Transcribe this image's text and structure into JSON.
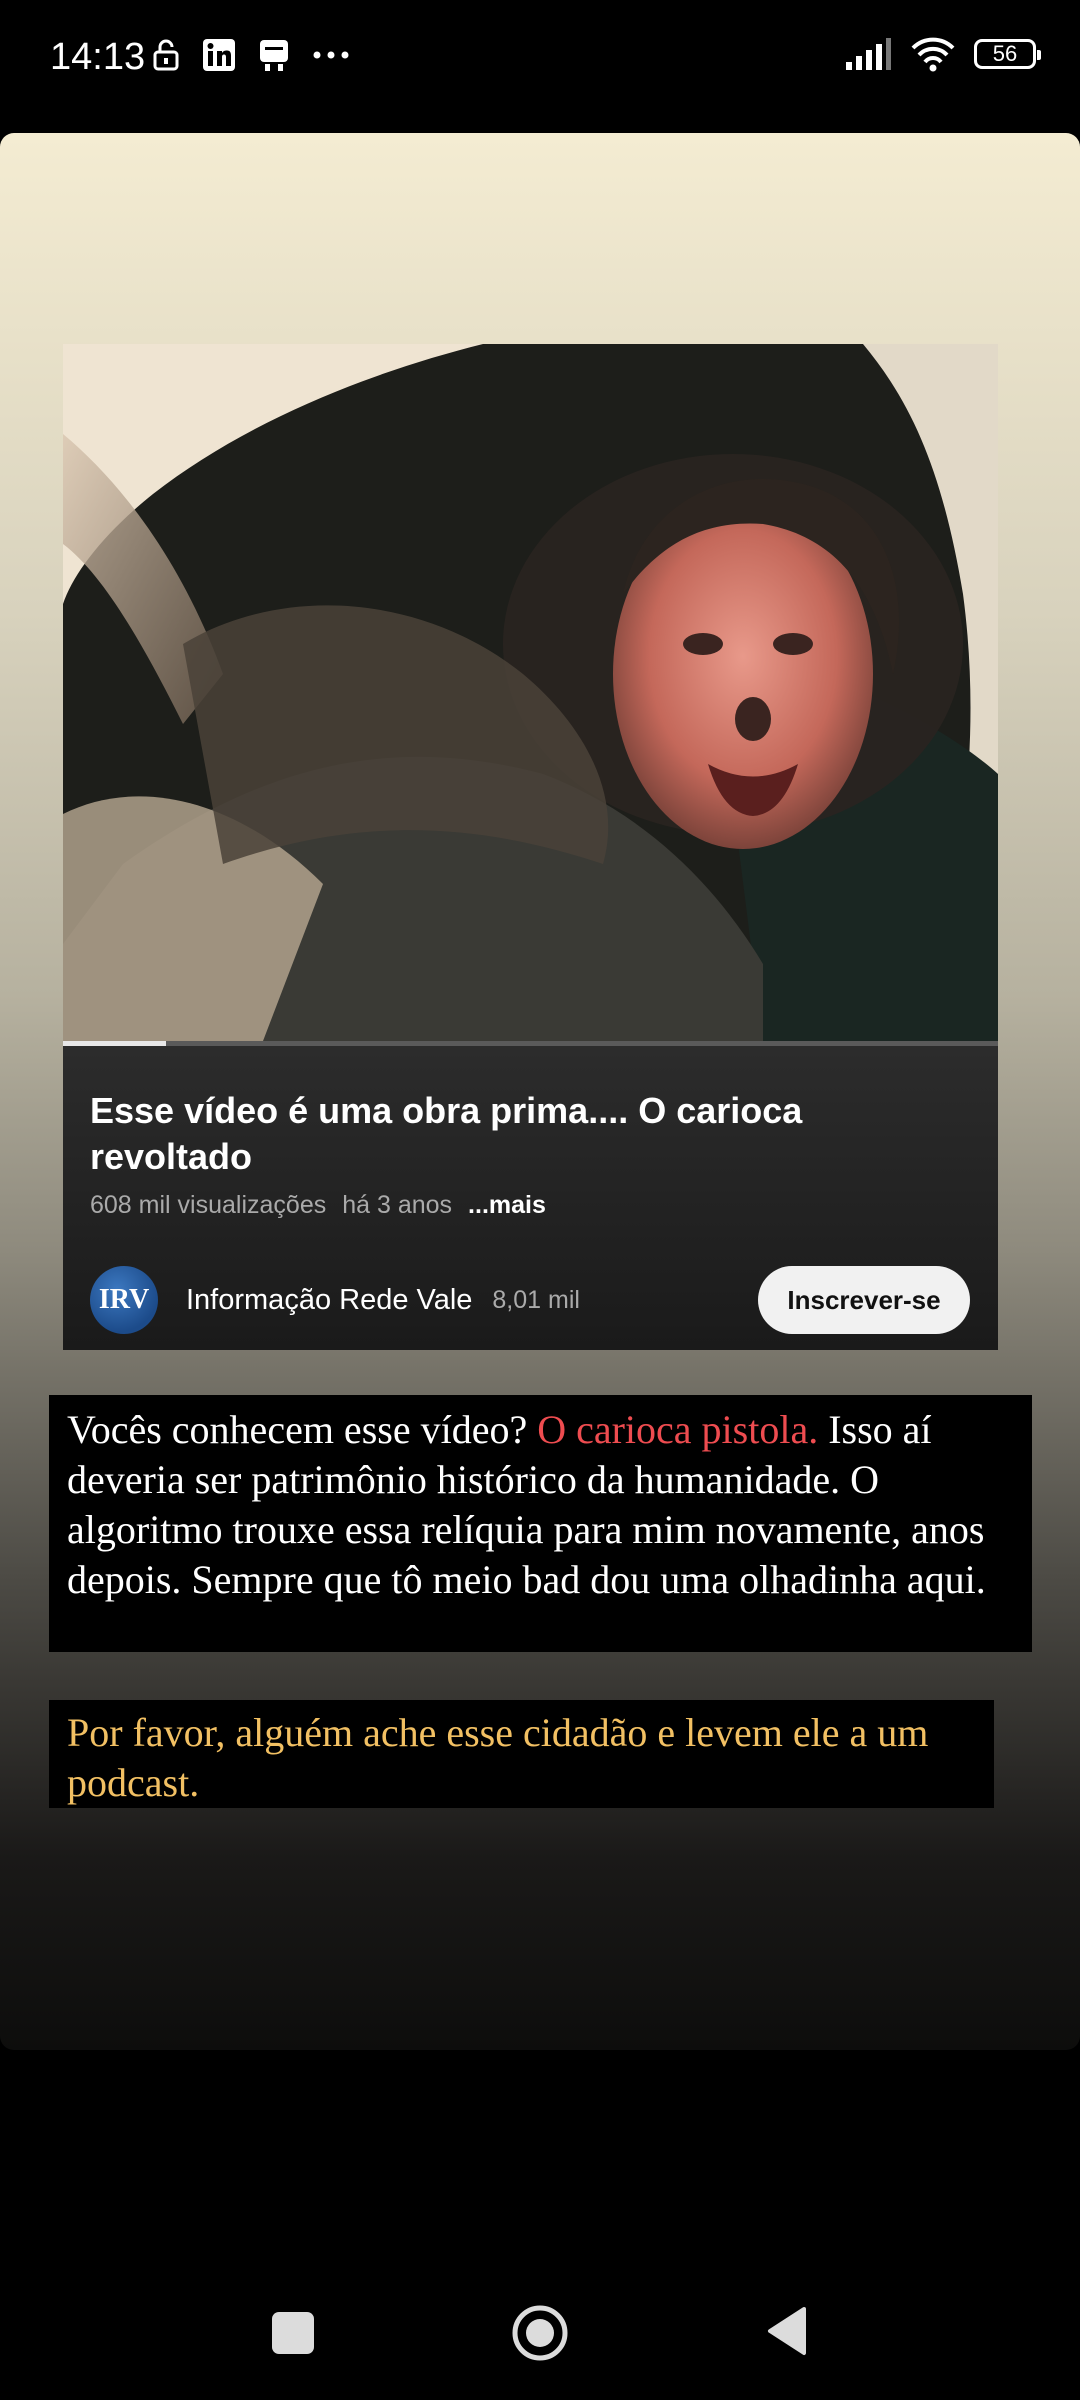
{
  "status_bar": {
    "time": "14:13",
    "left_icons": [
      "lock-open-icon",
      "linkedin-icon",
      "notification-icon",
      "more-dots-icon"
    ],
    "right_icons": [
      "signal-icon",
      "wifi-icon",
      "battery-icon"
    ],
    "battery_level": "56"
  },
  "video": {
    "title": "Esse vídeo é uma obra prima.... O carioca revoltado",
    "views": "608 mil visualizações",
    "age": "há 3 anos",
    "more_label": "...mais",
    "progress_fraction": 0.11,
    "channel": {
      "avatar_text": "IRV",
      "name": "Informação Rede Vale",
      "subscribers": "8,01 mil"
    },
    "subscribe_label": "Inscrever-se"
  },
  "captions": {
    "first_part1": "Vocês conhecem esse vídeo? ",
    "first_highlight": "O carioca pistola.",
    "first_part2": " Isso aí deveria ser patrimônio histórico da humanidade. O algoritmo trouxe essa relíquia para mim novamente, anos depois. Sempre que tô meio bad dou uma olhadinha aqui.",
    "second": "Por favor, alguém ache esse cidadão e levem ele a um podcast."
  },
  "nav": [
    "recents-button",
    "home-button",
    "back-button"
  ],
  "colors": {
    "highlight_red": "#ee4c50",
    "highlight_yellow": "#f2c063"
  }
}
